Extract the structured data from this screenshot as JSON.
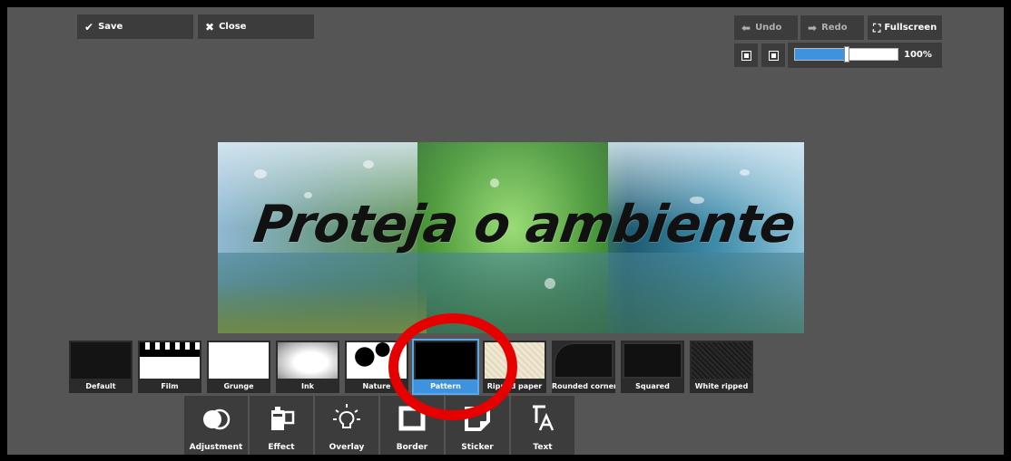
{
  "toolbar": {
    "save_label": "Save",
    "close_label": "Close",
    "undo_label": "Undo",
    "redo_label": "Redo",
    "fullscreen_label": "Fullscreen"
  },
  "zoom": {
    "value_label": "100%",
    "slider_fraction": 0.5
  },
  "canvas": {
    "caption": "Proteja o ambiente"
  },
  "borders": [
    {
      "label": "Default",
      "selected": false
    },
    {
      "label": "Film",
      "selected": false
    },
    {
      "label": "Grunge",
      "selected": false
    },
    {
      "label": "Ink",
      "selected": false
    },
    {
      "label": "Nature",
      "selected": false
    },
    {
      "label": "Pattern",
      "selected": true
    },
    {
      "label": "Ripped paper",
      "selected": false
    },
    {
      "label": "Rounded corner",
      "selected": false
    },
    {
      "label": "Squared",
      "selected": false
    },
    {
      "label": "White ripped",
      "selected": false
    }
  ],
  "tools": [
    {
      "label": "Adjustment",
      "icon": "adjustment-icon"
    },
    {
      "label": "Effect",
      "icon": "effect-icon"
    },
    {
      "label": "Overlay",
      "icon": "overlay-icon"
    },
    {
      "label": "Border",
      "icon": "border-icon"
    },
    {
      "label": "Sticker",
      "icon": "sticker-icon"
    },
    {
      "label": "Text",
      "icon": "text-icon"
    }
  ],
  "colors": {
    "accent": "#3d93de",
    "panel": "#3c3c3c",
    "background": "#555555",
    "annotation_ring": "#e60000"
  }
}
